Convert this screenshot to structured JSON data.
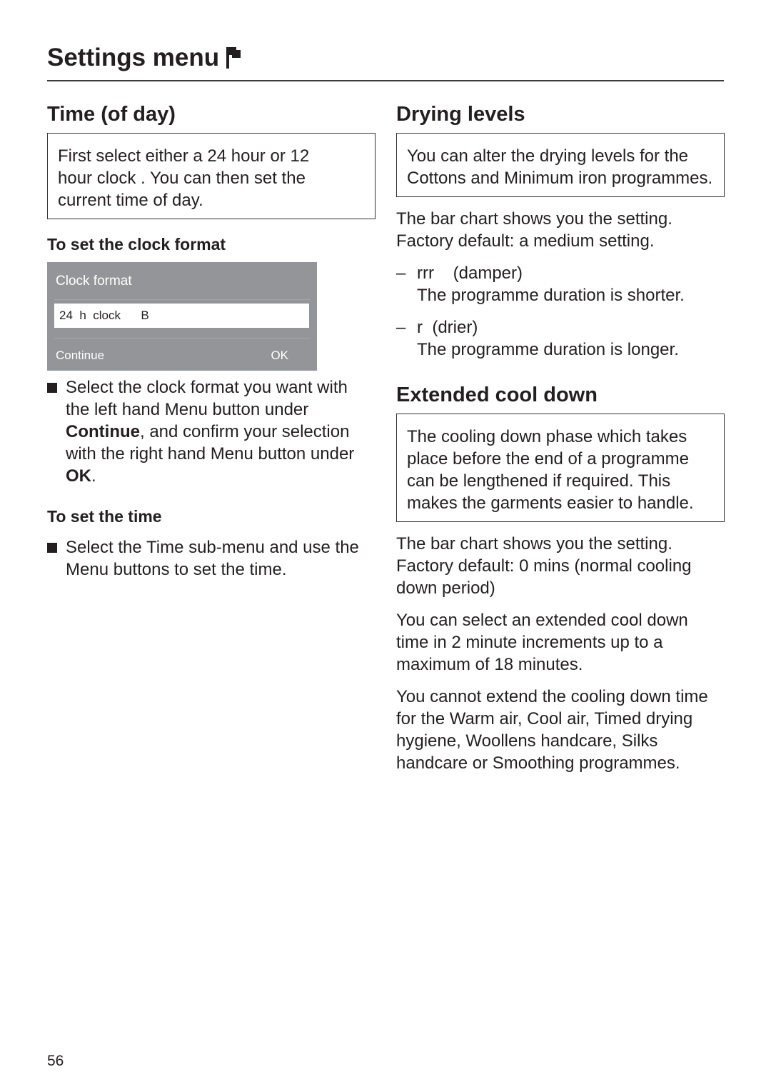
{
  "header": {
    "title": "Settings menu",
    "icon": "flag-icon"
  },
  "time_of_day": {
    "heading": "Time (of day)",
    "intro_lines": [
      "First select either a 24 hour or 12",
      "hour clock . You can then set the",
      "current time of day."
    ],
    "clock_format_heading": "To set the clock format",
    "display_panel": {
      "title": "Clock format",
      "value": "24  h  clock      B",
      "left_button": "Continue",
      "right_button": "OK"
    },
    "clock_format_step": {
      "t1": "Select the clock format you want with the left hand ",
      "menu1": "Menu",
      "t2": " button under ",
      "continue": "Continue",
      "t3": ", and confirm your selection with the right hand ",
      "menu2": "Menu",
      "t4": " button under ",
      "ok": "OK",
      "t5": "."
    },
    "set_time_heading": "To set the time",
    "set_time_step": {
      "t1": "Select the Time sub-menu and use the ",
      "menu": "Menu",
      "t2": " buttons to set the time."
    }
  },
  "drying_levels": {
    "heading": "Drying levels",
    "intro": {
      "t1": "You can alter the drying levels for the ",
      "cottons": "Cottons",
      "t2": " and ",
      "min_iron": "Minimum iron",
      "t3": " programmes."
    },
    "bar_chart_text": "The bar chart shows you the setting. Factory default: a medium setting.",
    "items": [
      {
        "dash": "–",
        "symbol": "rrr",
        "label": "(damper)",
        "desc": "The programme duration is shorter."
      },
      {
        "dash": "–",
        "symbol": "r",
        "label": "(drier)",
        "desc": "The programme duration is longer."
      }
    ]
  },
  "extended_cool_down": {
    "heading": "Extended cool down",
    "intro": "The cooling down phase which takes place before the end of a programme can be lengthened if required.  This makes the garments easier to handle.",
    "paragraphs": [
      "The bar chart shows you the setting. Factory default: 0 mins (normal cooling down period)",
      "You can select an extended cool down time in 2 minute increments up to a maximum of 18 minutes.",
      "You cannot extend the cooling down time for the Warm air, Cool air, Timed drying hygiene, Woollens handcare, Silks handcare or Smoothing programmes."
    ]
  },
  "footer": {
    "page_number": "56"
  }
}
